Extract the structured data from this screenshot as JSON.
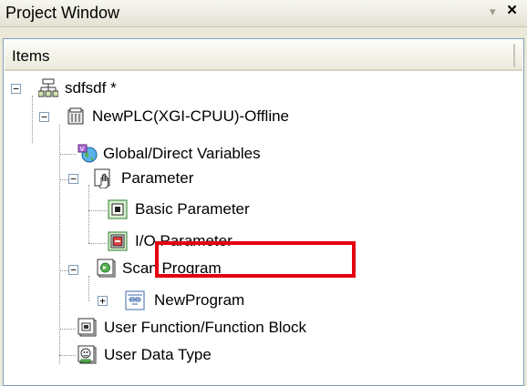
{
  "window": {
    "title": "Project Window",
    "pin_glyph": "▾",
    "close_glyph": "×"
  },
  "header": {
    "label": "Items"
  },
  "tree": {
    "project": {
      "label": "sdfsdf *",
      "icon": "project-icon",
      "expander": "−"
    },
    "plc": {
      "label": "NewPLC(XGI-CPUU)-Offline",
      "icon": "plc-icon",
      "expander": "−"
    },
    "global_vars": {
      "label": "Global/Direct Variables",
      "icon": "globe-variables-icon"
    },
    "parameter": {
      "label": "Parameter",
      "icon": "hand-parameter-icon",
      "expander": "−"
    },
    "basic_param": {
      "label": "Basic Parameter",
      "icon": "basic-parameter-icon"
    },
    "io_param": {
      "label": "I/O Parameter",
      "icon": "io-parameter-icon"
    },
    "scan_program": {
      "label": "Scan Program",
      "icon": "scan-program-icon",
      "expander": "−"
    },
    "new_program": {
      "label": "NewProgram",
      "icon": "program-icon",
      "expander": "+"
    },
    "user_function": {
      "label": "User Function/Function Block",
      "icon": "function-block-icon"
    },
    "user_data_type": {
      "label": "User Data Type",
      "icon": "data-type-icon"
    }
  },
  "colors": {
    "highlight_border": "#e4000f",
    "panel_border": "#7f9db9"
  }
}
